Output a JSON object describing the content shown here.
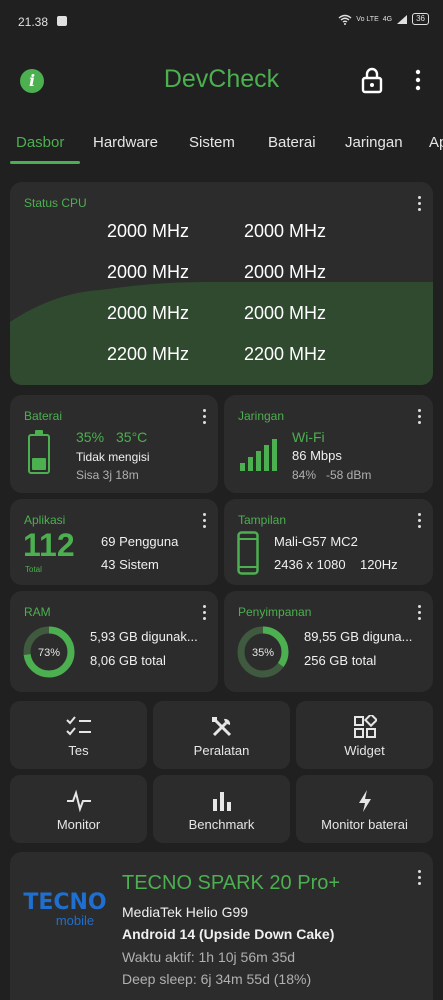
{
  "status_bar": {
    "time": "21.38",
    "battery": "36",
    "signal_labels": [
      "Vo LTE",
      "4G"
    ]
  },
  "app_bar": {
    "title": "DevCheck",
    "info_icon": "info-icon",
    "lock_icon": "lock-icon",
    "menu_icon": "more-vert-icon"
  },
  "tabs": [
    {
      "label": "Dasbor",
      "active": true
    },
    {
      "label": "Hardware"
    },
    {
      "label": "Sistem"
    },
    {
      "label": "Baterai"
    },
    {
      "label": "Jaringan"
    },
    {
      "label": "Ap"
    }
  ],
  "cpu": {
    "title": "Status CPU",
    "freqs": [
      "2000 MHz",
      "2000 MHz",
      "2000 MHz",
      "2000 MHz",
      "2000 MHz",
      "2000 MHz",
      "2200 MHz",
      "2200 MHz"
    ]
  },
  "battery": {
    "title": "Baterai",
    "level": "35%",
    "level_fraction": 0.35,
    "temp": "35°C",
    "status": "Tidak mengisi",
    "remaining": "Sisa 3j 18m"
  },
  "network": {
    "title": "Jaringan",
    "type": "Wi-Fi",
    "speed": "86 Mbps",
    "signal_pct": "84%",
    "dbm": "-58 dBm"
  },
  "apps": {
    "title": "Aplikasi",
    "total": "112",
    "total_label": "Total",
    "user": "69 Pengguna",
    "system": "43 Sistem"
  },
  "display": {
    "title": "Tampilan",
    "gpu": "Mali-G57 MC2",
    "resolution": "2436 x 1080",
    "refresh": "120Hz"
  },
  "ram": {
    "title": "RAM",
    "percent": "73%",
    "used_fraction": 0.73,
    "used": "5,93 GB digunak...",
    "total": "8,06 GB total"
  },
  "storage": {
    "title": "Penyimpanan",
    "percent": "35%",
    "used_fraction": 0.35,
    "used": "89,55 GB diguna...",
    "total": "256 GB total"
  },
  "tools": [
    {
      "label": "Tes",
      "icon": "checklist-icon"
    },
    {
      "label": "Peralatan",
      "icon": "tools-icon"
    },
    {
      "label": "Widget",
      "icon": "widget-icon"
    },
    {
      "label": "Monitor",
      "icon": "pulse-icon"
    },
    {
      "label": "Benchmark",
      "icon": "bar-chart-icon"
    },
    {
      "label": "Monitor baterai",
      "icon": "bolt-icon"
    }
  ],
  "device": {
    "brand_logo": "TECNO",
    "brand_sub": "mobile",
    "name": "TECNO SPARK 20 Pro+",
    "chipset": "MediaTek Helio G99",
    "android": "Android 14 (Upside Down Cake)",
    "uptime": "Waktu aktif: 1h 10j 56m 35d",
    "deep_sleep": "Deep sleep: 6j 34m 55d (18%)"
  },
  "colors": {
    "accent": "#4caf50",
    "background": "#202020",
    "card": "#2c2c2c"
  }
}
